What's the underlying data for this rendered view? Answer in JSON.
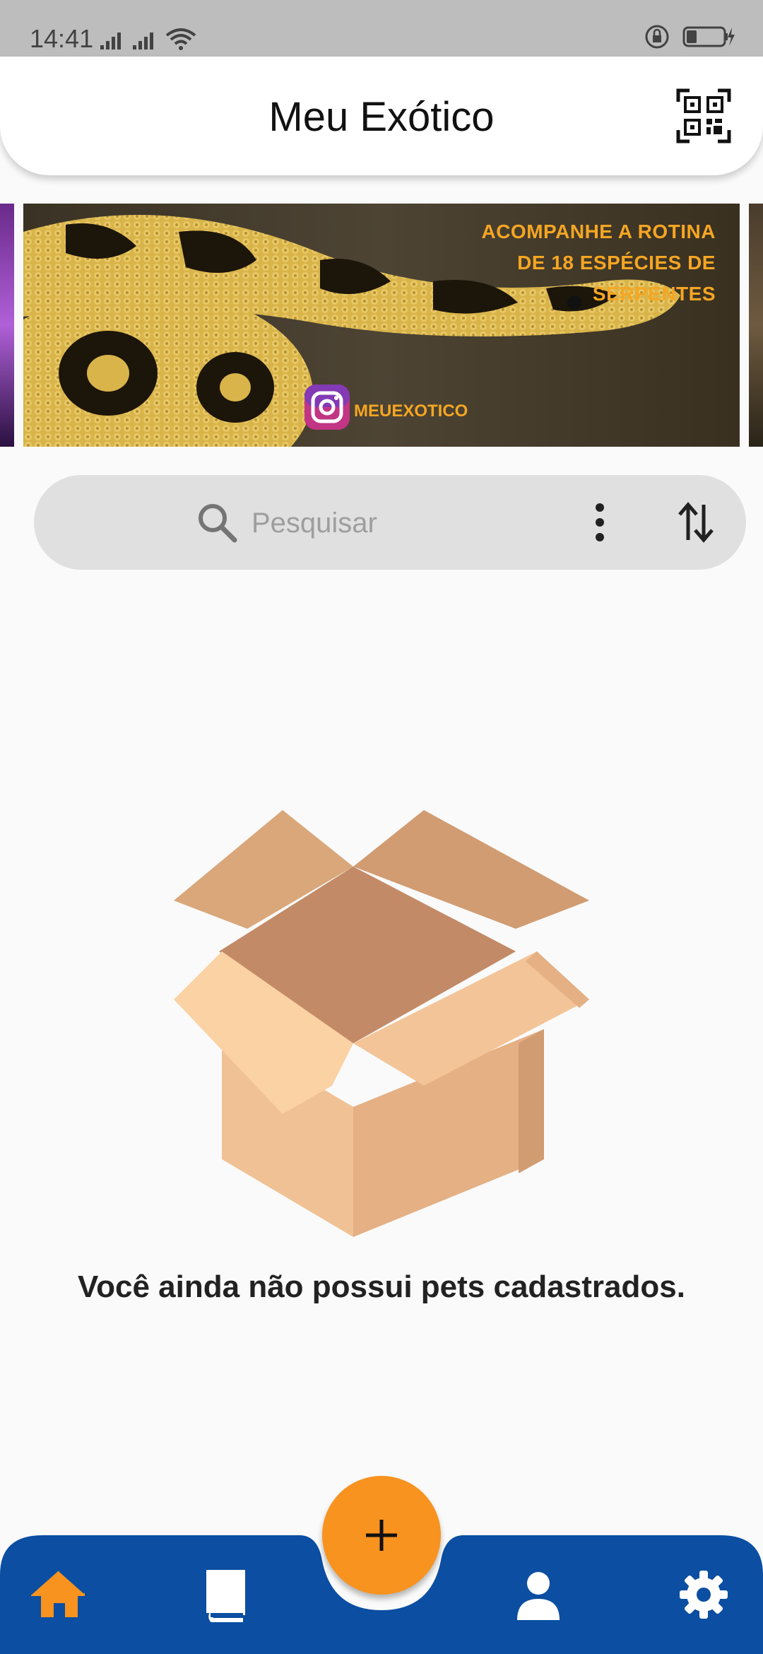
{
  "status_bar": {
    "time": "14:41"
  },
  "app_bar": {
    "title": "Meu Exótico"
  },
  "banner": {
    "headline_lines": [
      "ACOMPANHE A ROTINA",
      "DE 18 ESPÉCIES DE",
      "SERPENTES"
    ],
    "instagram_handle": "MEUEXOTICO"
  },
  "search": {
    "placeholder": "Pesquisar"
  },
  "empty_state": {
    "message": "Você ainda não possui pets cadastrados."
  },
  "bottom_nav": {
    "items": [
      "home",
      "catalog",
      "add",
      "profile",
      "settings"
    ],
    "active": "home"
  },
  "colors": {
    "accent": "#f7931e",
    "nav_background": "#0b4ea2",
    "search_background": "#e0e0e0",
    "banner_text": "#f5a623"
  }
}
